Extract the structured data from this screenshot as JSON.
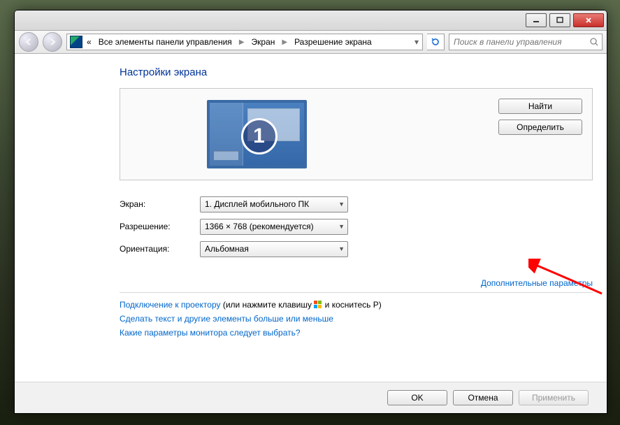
{
  "breadcrumbs": {
    "prefix": "«",
    "root": "Все элементы панели управления",
    "level1": "Экран",
    "level2": "Разрешение экрана"
  },
  "search": {
    "placeholder": "Поиск в панели управления"
  },
  "heading": "Настройки экрана",
  "display_number": "1",
  "buttons": {
    "detect": "Найти",
    "identify": "Определить",
    "ok": "OK",
    "cancel": "Отмена",
    "apply": "Применить"
  },
  "form": {
    "display_label": "Экран:",
    "display_value": "1. Дисплей мобильного ПК",
    "resolution_label": "Разрешение:",
    "resolution_value": "1366 × 768 (рекомендуется)",
    "orientation_label": "Ориентация:",
    "orientation_value": "Альбомная"
  },
  "links": {
    "advanced": "Дополнительные параметры",
    "projector_link": "Подключение к проектору",
    "projector_suffix_before": " (или нажмите клавишу ",
    "projector_suffix_after": " и коснитесь P)",
    "text_size": "Сделать текст и другие элементы больше или меньше",
    "which_monitor": "Какие параметры монитора следует выбрать?"
  }
}
